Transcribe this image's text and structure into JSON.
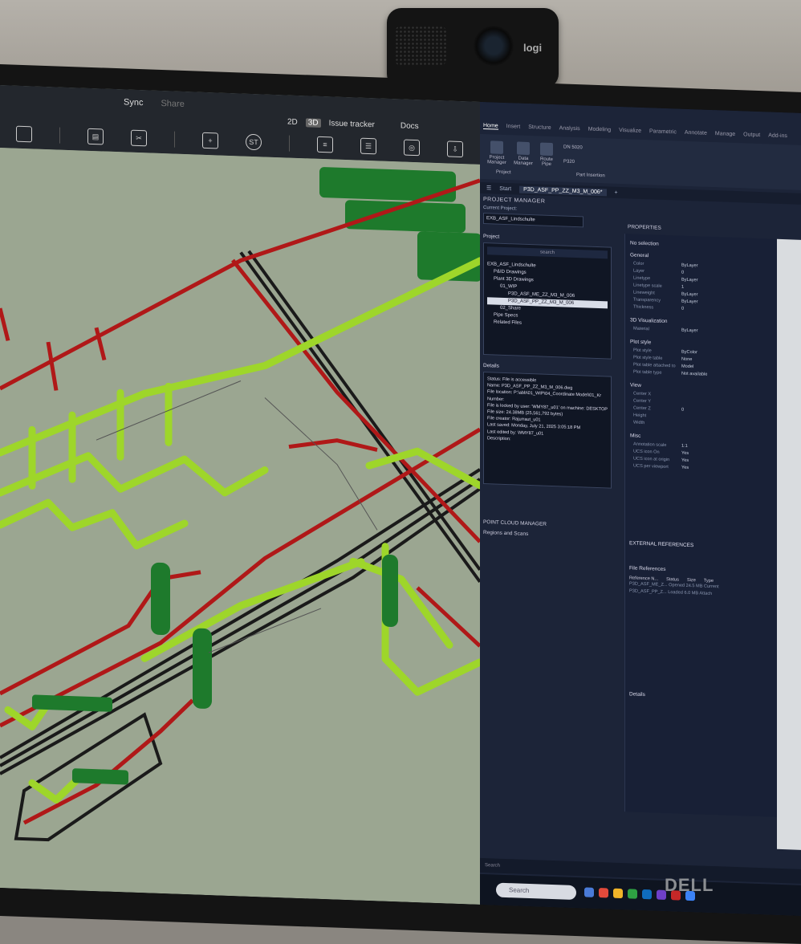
{
  "webcam": {
    "brand": "logi"
  },
  "viewer": {
    "tabs": {
      "sync": "Sync",
      "share": "Share"
    },
    "modes": {
      "two_d": "2D",
      "three_d": "3D",
      "issue_tracker": "Issue tracker",
      "docs": "Docs"
    },
    "st_button": "ST",
    "colors": {
      "pipe_red": "#b01818",
      "pipe_green": "#9ed62a",
      "pipe_dark": "#1a1a1a",
      "equip_green": "#1e7a2c",
      "background": "#9aa590"
    }
  },
  "cad": {
    "ribbon_tabs": [
      "Home",
      "Insert",
      "Structure",
      "Analysis",
      "Modeling",
      "Visualize",
      "Parametric",
      "Annotate",
      "Manage",
      "Output",
      "Add-ins"
    ],
    "ribbon": {
      "project_manager": "Project Manager",
      "data_manager": "Data Manager",
      "route_pipe": "Route Pipe",
      "project_group": "Project",
      "part_insertion": "Part Insertion",
      "size_value": "DN 5020",
      "spec_value": "P320"
    },
    "doc_tabs": {
      "start": "Start",
      "current": "P3D_ASF_PP_ZZ_M3_M_006*"
    },
    "project_manager": {
      "header": "PROJECT MANAGER",
      "current_project_label": "Current Project:",
      "current_project_value": "EXB_ASF_Lindschulte",
      "project_label": "Project",
      "search_placeholder": "search",
      "tree": [
        "EXB_ASF_Lindschulte",
        "P&ID Drawings",
        "Plant 3D Drawings",
        "01_WIP",
        "P3D_ASF_ME_ZZ_M3_M_006",
        "P3D_ASF_PP_ZZ_M3_M_006",
        "02_Share",
        "Pipe Specs",
        "Related Files"
      ]
    },
    "details": {
      "header": "Details",
      "lines": [
        "Status: File is accessible",
        "Name: P3D_ASF_PP_ZZ_M3_M_006.dwg",
        "File location: P:\\abb\\01_WIP\\04_Coordinate Model\\01_Kr",
        "Number:",
        "File is locked by user: 'WMY87_u01' on machine: DESKTOP",
        "File size: 24.38MB (25,561,792 bytes)",
        "File creator: Rajurraut_u01",
        "Last saved: Monday, July 21, 2025 3:05:18 PM",
        "Last edited by: WMY87_u01",
        "Description:"
      ]
    },
    "point_cloud": {
      "header": "POINT CLOUD MANAGER",
      "regions": "Regions and Scans"
    },
    "properties": {
      "header": "PROPERTIES",
      "selection": "No selection",
      "general": "General",
      "general_rows": [
        [
          "Color",
          "ByLayer"
        ],
        [
          "Layer",
          "0"
        ],
        [
          "Linetype",
          "ByLayer"
        ],
        [
          "Linetype scale",
          "1"
        ],
        [
          "Lineweight",
          "ByLayer"
        ],
        [
          "Transparency",
          "ByLayer"
        ],
        [
          "Thickness",
          "0"
        ]
      ],
      "visualizations": "3D Visualization",
      "material_row": [
        "Material",
        "ByLayer"
      ],
      "plot_style": "Plot style",
      "plot_rows": [
        [
          "Plot style",
          "ByColor"
        ],
        [
          "Plot style table",
          "None"
        ],
        [
          "Plot table attached to",
          "Model"
        ],
        [
          "Plot table type",
          "Not available"
        ]
      ],
      "view": "View",
      "view_rows": [
        [
          "Center X",
          ""
        ],
        [
          "Center Y",
          ""
        ],
        [
          "Center Z",
          "0"
        ],
        [
          "Height",
          ""
        ],
        [
          "Width",
          ""
        ]
      ],
      "misc": "Misc",
      "misc_rows": [
        [
          "Annotation scale",
          "1:1"
        ],
        [
          "UCS icon On",
          "Yes"
        ],
        [
          "UCS icon at origin",
          "Yes"
        ],
        [
          "UCS per viewport",
          "Yes"
        ]
      ]
    },
    "external_references": {
      "header": "EXTERNAL REFERENCES",
      "file_references": "File References",
      "columns": [
        "Reference N...",
        "Status",
        "Size",
        "Type"
      ],
      "rows": [
        [
          "P3D_ASF_ME_Z...",
          "Opened",
          "24.5 MB",
          "Current"
        ],
        [
          "P3D_ASF_PP_Z...",
          "Loaded",
          "6.0 MB",
          "Attach"
        ]
      ],
      "details": "Details"
    },
    "status_search": "Search"
  },
  "taskbar": {
    "search": "Search"
  },
  "monitor": {
    "brand": "DELL"
  }
}
